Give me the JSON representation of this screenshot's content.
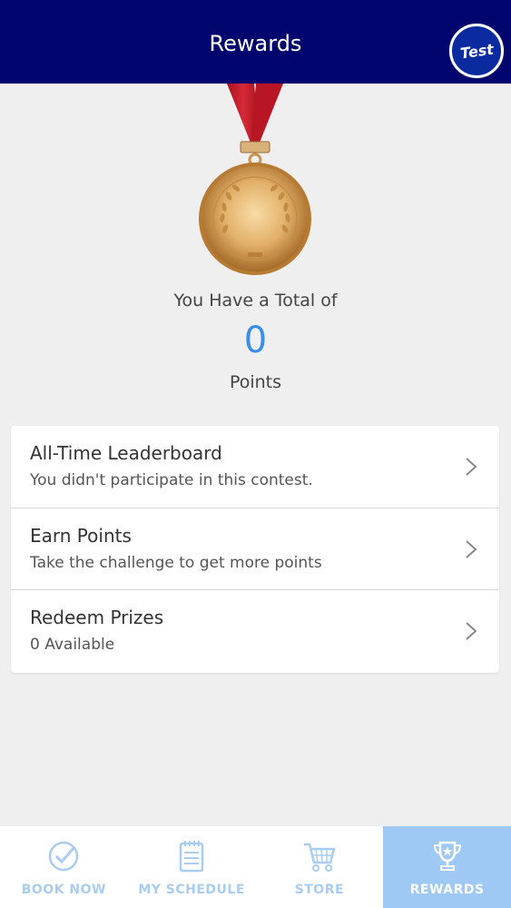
{
  "header": {
    "title": "Rewards",
    "avatar_text": "Test"
  },
  "summary": {
    "total_label": "You Have a Total of",
    "points_value": "0",
    "points_label": "Points"
  },
  "menu": {
    "items": [
      {
        "title": "All-Time Leaderboard",
        "subtitle": "You didn't participate in this contest."
      },
      {
        "title": "Earn Points",
        "subtitle": "Take the challenge to get more points"
      },
      {
        "title": "Redeem Prizes",
        "subtitle": "0 Available"
      }
    ]
  },
  "bottom_nav": {
    "items": [
      {
        "label": "BOOK NOW",
        "icon": "check-circle-icon",
        "active": false
      },
      {
        "label": "MY SCHEDULE",
        "icon": "notepad-icon",
        "active": false
      },
      {
        "label": "STORE",
        "icon": "cart-icon",
        "active": false
      },
      {
        "label": "REWARDS",
        "icon": "trophy-icon",
        "active": true
      }
    ]
  },
  "colors": {
    "header_bg": "#00066e",
    "accent": "#3a8ee6",
    "nav_active_bg": "#9ec9f5",
    "nav_inactive": "#a9cdf0",
    "ribbon": "#c8202f",
    "medal": "#d9a45a"
  }
}
